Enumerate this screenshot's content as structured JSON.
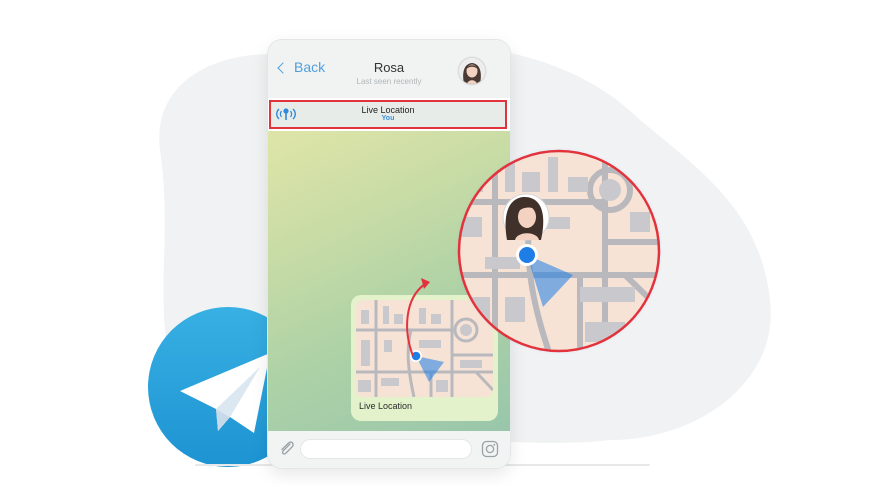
{
  "header": {
    "back_label": "Back",
    "contact_name": "Rosa",
    "contact_status": "Last seen recently"
  },
  "live_location_bar": {
    "title": "Live Location",
    "subtitle": "You"
  },
  "message": {
    "caption": "Live Location"
  },
  "icons": [
    "chevron-left-icon",
    "live-location-icon",
    "paperclip-icon",
    "camera-icon",
    "telegram-logo-icon",
    "location-pin-icon"
  ],
  "colors": {
    "accent_blue": "#4f9fe0",
    "highlight_red": "#e2333d",
    "map_background": "#f7e3d6",
    "map_road": "#b9b9bd",
    "location_dot": "#1f7de6",
    "telegram_blue": "#2ea5de"
  }
}
